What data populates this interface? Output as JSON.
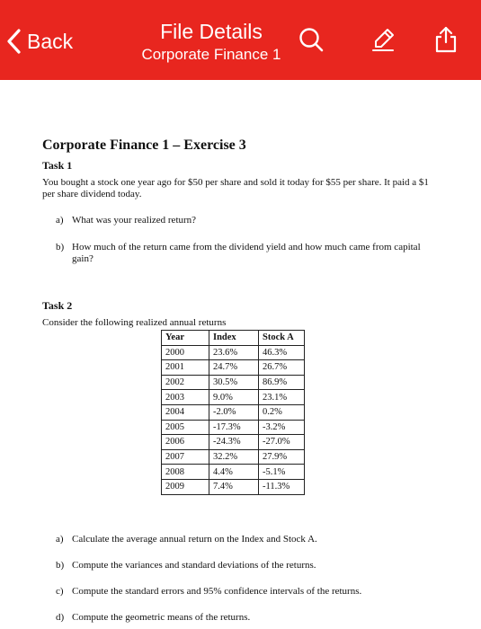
{
  "header": {
    "back_label": "Back",
    "title": "File Details",
    "subtitle": "Corporate Finance 1",
    "background": "#e8261f",
    "icons": [
      "chevron-left-icon",
      "search-icon",
      "pencil-icon",
      "share-icon"
    ]
  },
  "document": {
    "title": "Corporate Finance 1 – Exercise 3",
    "task1": {
      "heading": "Task 1",
      "text": "You bought a stock one year ago for $50 per share and sold it today for $55 per share. It paid a $1 per share dividend today.",
      "questions": [
        {
          "label": "a)",
          "text": "What was your realized return?"
        },
        {
          "label": "b)",
          "text": "How much of the return came from the dividend yield and how much came from capital gain?"
        }
      ]
    },
    "task2": {
      "heading": "Task 2",
      "intro": "Consider the following realized annual returns",
      "table": {
        "headers": [
          "Year",
          "Index",
          "Stock A"
        ],
        "rows": [
          [
            "2000",
            "23.6%",
            "46.3%"
          ],
          [
            "2001",
            "24.7%",
            "26.7%"
          ],
          [
            "2002",
            "30.5%",
            "86.9%"
          ],
          [
            "2003",
            "9.0%",
            "23.1%"
          ],
          [
            "2004",
            "-2.0%",
            "0.2%"
          ],
          [
            "2005",
            "-17.3%",
            "-3.2%"
          ],
          [
            "2006",
            "-24.3%",
            "-27.0%"
          ],
          [
            "2007",
            "32.2%",
            "27.9%"
          ],
          [
            "2008",
            "4.4%",
            "-5.1%"
          ],
          [
            "2009",
            "7.4%",
            "-11.3%"
          ]
        ]
      },
      "questions": [
        {
          "label": "a)",
          "text": "Calculate the average annual return on the Index and Stock A."
        },
        {
          "label": "b)",
          "text": "Compute the variances and standard deviations of the returns."
        },
        {
          "label": "c)",
          "text": "Compute the standard errors and 95% confidence intervals of the returns."
        },
        {
          "label": "d)",
          "text": "Compute the geometric means of the returns."
        }
      ]
    }
  }
}
